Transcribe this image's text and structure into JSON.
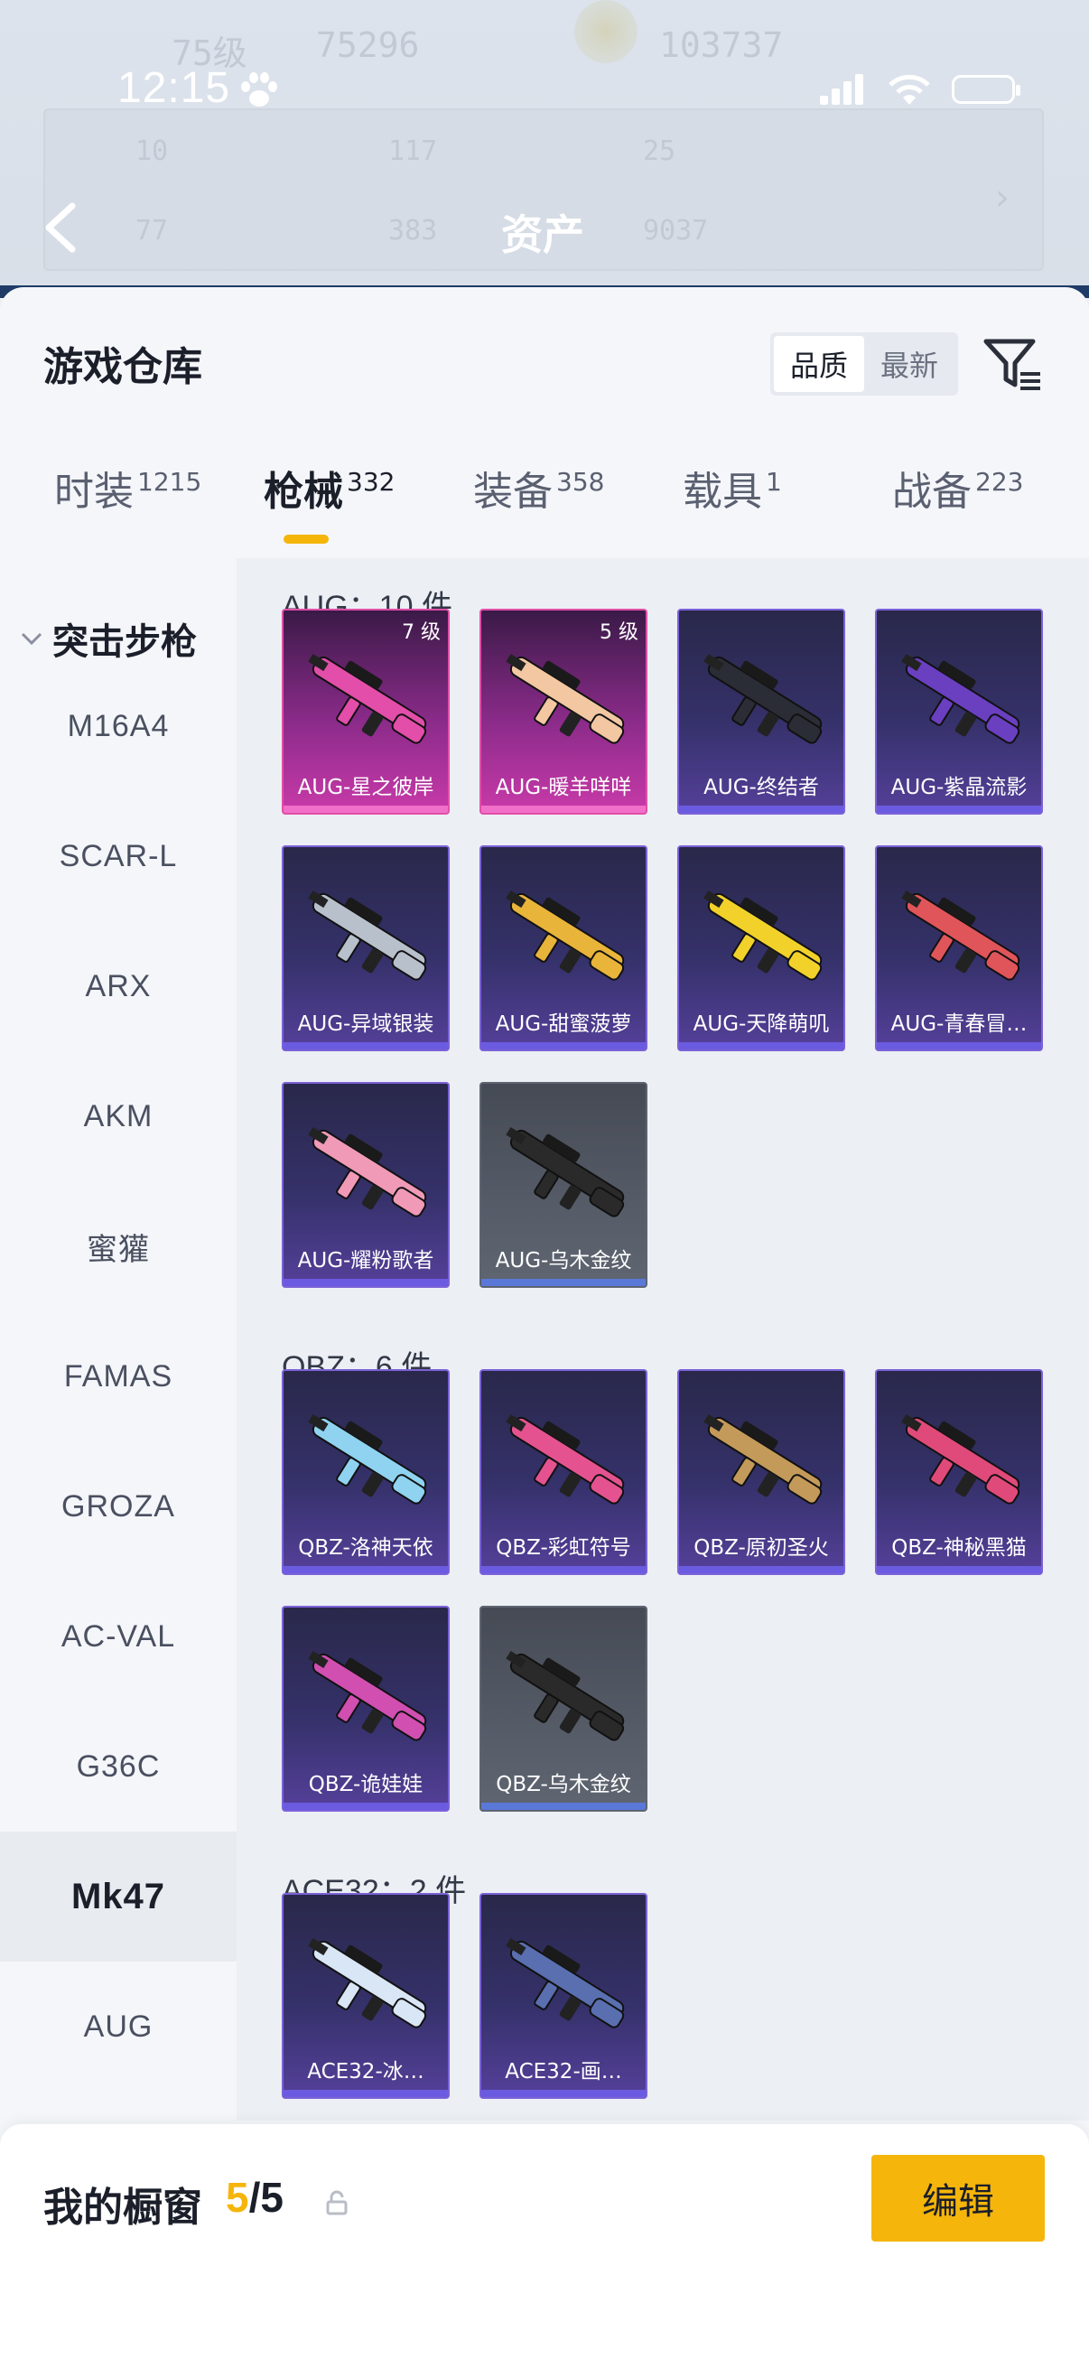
{
  "status_bar": {
    "time": "12:15"
  },
  "background_header": {
    "title": "资产",
    "ghost_values": [
      "75级",
      "75296",
      "103737",
      "10",
      "117",
      "25",
      "77",
      "383",
      "9037"
    ]
  },
  "warehouse": {
    "title": "游戏仓库",
    "sort_options": [
      {
        "label": "品质",
        "active": true
      },
      {
        "label": "最新",
        "active": false
      }
    ]
  },
  "tabs": [
    {
      "label": "时装",
      "count": "1215",
      "active": false
    },
    {
      "label": "枪械",
      "count": "332",
      "active": true
    },
    {
      "label": "装备",
      "count": "358",
      "active": false
    },
    {
      "label": "载具",
      "count": "1",
      "active": false
    },
    {
      "label": "战备",
      "count": "223",
      "active": false
    }
  ],
  "sidebar": {
    "category": "突击步枪",
    "items": [
      "M16A4",
      "SCAR-L",
      "ARX",
      "AKM",
      "蜜獾",
      "FAMAS",
      "GROZA",
      "AC-VAL",
      "G36C",
      "Mk47",
      "AUG"
    ],
    "active": "Mk47"
  },
  "groups": [
    {
      "title": "AUG：10 件",
      "items": [
        {
          "name": "AUG-星之彼岸",
          "level": "7 级",
          "quality": "pink",
          "color": "#e24ea9"
        },
        {
          "name": "AUG-暖羊咩咩",
          "level": "5 级",
          "quality": "pink",
          "color": "#f3c7a2"
        },
        {
          "name": "AUG-终结者",
          "quality": "purple",
          "color": "#2b2d36"
        },
        {
          "name": "AUG-紫晶流影",
          "quality": "purple",
          "color": "#6a3fc0"
        },
        {
          "name": "AUG-异域银装",
          "quality": "purple",
          "color": "#b8c0cc"
        },
        {
          "name": "AUG-甜蜜菠萝",
          "quality": "purple",
          "color": "#e8b43a"
        },
        {
          "name": "AUG-天降萌叽",
          "quality": "purple",
          "color": "#f2d22a"
        },
        {
          "name": "AUG-青春冒…",
          "quality": "purple",
          "color": "#e0555a"
        },
        {
          "name": "AUG-耀粉歌者",
          "quality": "purple",
          "color": "#f09ab8"
        },
        {
          "name": "AUG-乌木金纹",
          "quality": "grey",
          "color": "#2a2a2a"
        }
      ]
    },
    {
      "title": "QBZ：6 件",
      "items": [
        {
          "name": "QBZ-洛神天依",
          "quality": "purple",
          "color": "#8fd3f0"
        },
        {
          "name": "QBZ-彩虹符号",
          "quality": "purple",
          "color": "#e4538f"
        },
        {
          "name": "QBZ-原初圣火",
          "quality": "purple",
          "color": "#c49a5a"
        },
        {
          "name": "QBZ-神秘黑猫",
          "quality": "purple",
          "color": "#e04a7a"
        },
        {
          "name": "QBZ-诡娃娃",
          "quality": "purple",
          "color": "#d04fb0"
        },
        {
          "name": "QBZ-乌木金纹",
          "quality": "grey",
          "color": "#2a2a2a"
        }
      ]
    },
    {
      "title": "ACE32：2 件",
      "items": [
        {
          "name": "ACE32-冰…",
          "quality": "purple",
          "color": "#d8e6f5"
        },
        {
          "name": "ACE32-画…",
          "quality": "purple",
          "color": "#5a6fb0"
        }
      ]
    }
  ],
  "showcase": {
    "label": "我的橱窗",
    "current": "5",
    "separator": "/",
    "total": "5",
    "edit_label": "编辑"
  },
  "icons": [
    "back-arrow-icon",
    "filter-icon",
    "chevron-down-icon",
    "share-icon",
    "lock-icon",
    "paw-icon",
    "signal-icon",
    "wifi-icon",
    "battery-icon"
  ]
}
